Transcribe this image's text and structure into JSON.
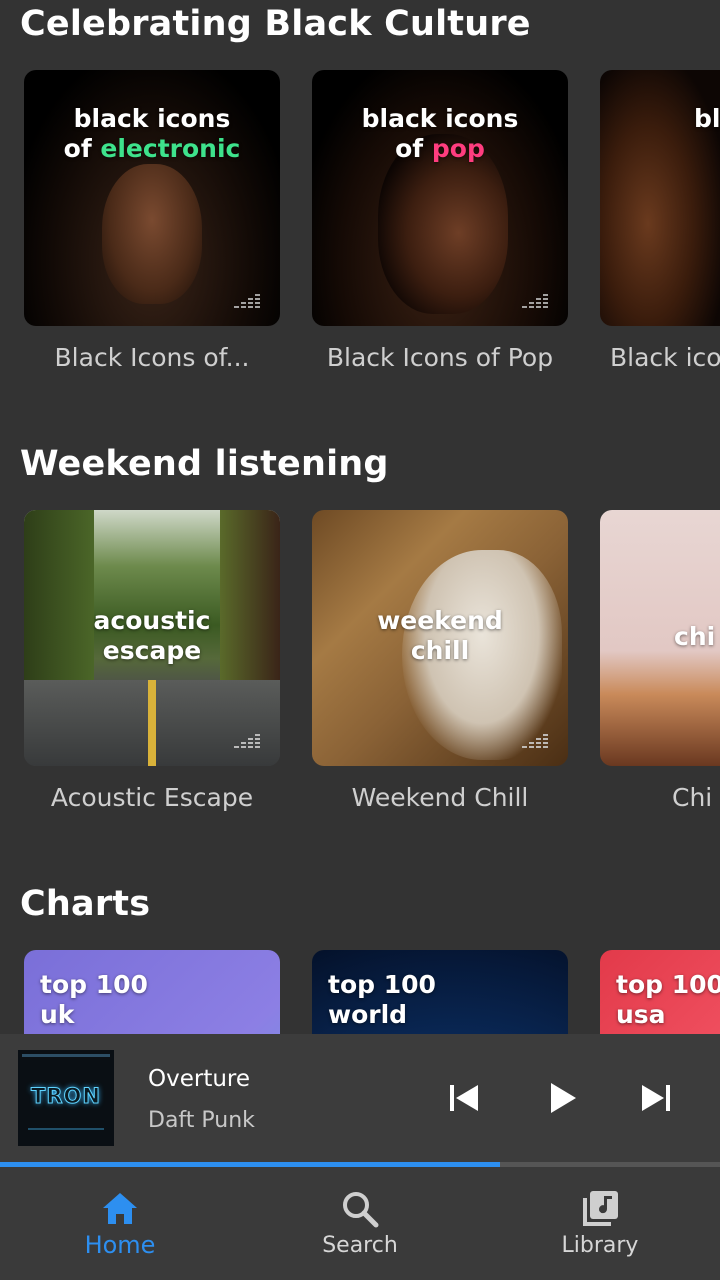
{
  "colors": {
    "background": "#333333",
    "accent": "#2d8ff0",
    "electronic_accent": "#3ee28c",
    "pop_accent": "#ff3d7f"
  },
  "sections": [
    {
      "title": "Celebrating Black Culture",
      "items": [
        {
          "cover_line1": "black icons",
          "cover_prefix": "of ",
          "cover_accent": "electronic",
          "caption": "Black Icons of..."
        },
        {
          "cover_line1": "black icons",
          "cover_prefix": "of ",
          "cover_accent": "pop",
          "caption": "Black Icons of Pop"
        },
        {
          "cover_line1": "bl",
          "caption": "Black ico"
        }
      ]
    },
    {
      "title": "Weekend listening",
      "items": [
        {
          "cover_line1": "acoustic",
          "cover_line2": "escape",
          "caption": "Acoustic Escape"
        },
        {
          "cover_line1": "weekend",
          "cover_line2": "chill",
          "caption": "Weekend Chill"
        },
        {
          "cover_line1": "chi",
          "caption": "Chi"
        }
      ]
    },
    {
      "title": "Charts",
      "items": [
        {
          "cover_line1": "top 100",
          "cover_line2": "uk"
        },
        {
          "cover_line1": "top 100",
          "cover_line2": "world"
        },
        {
          "cover_line1": "top 100",
          "cover_line2": "usa"
        }
      ]
    }
  ],
  "player": {
    "track_title": "Overture",
    "artist": "Daft Punk",
    "album_art_text": "TRON",
    "progress_percent": 69.5,
    "prev_icon": "skip-previous-icon",
    "play_icon": "play-icon",
    "next_icon": "skip-next-icon"
  },
  "nav": {
    "items": [
      {
        "label": "Home",
        "icon": "home-icon",
        "active": true
      },
      {
        "label": "Search",
        "icon": "search-icon",
        "active": false
      },
      {
        "label": "Library",
        "icon": "library-icon",
        "active": false
      }
    ]
  }
}
